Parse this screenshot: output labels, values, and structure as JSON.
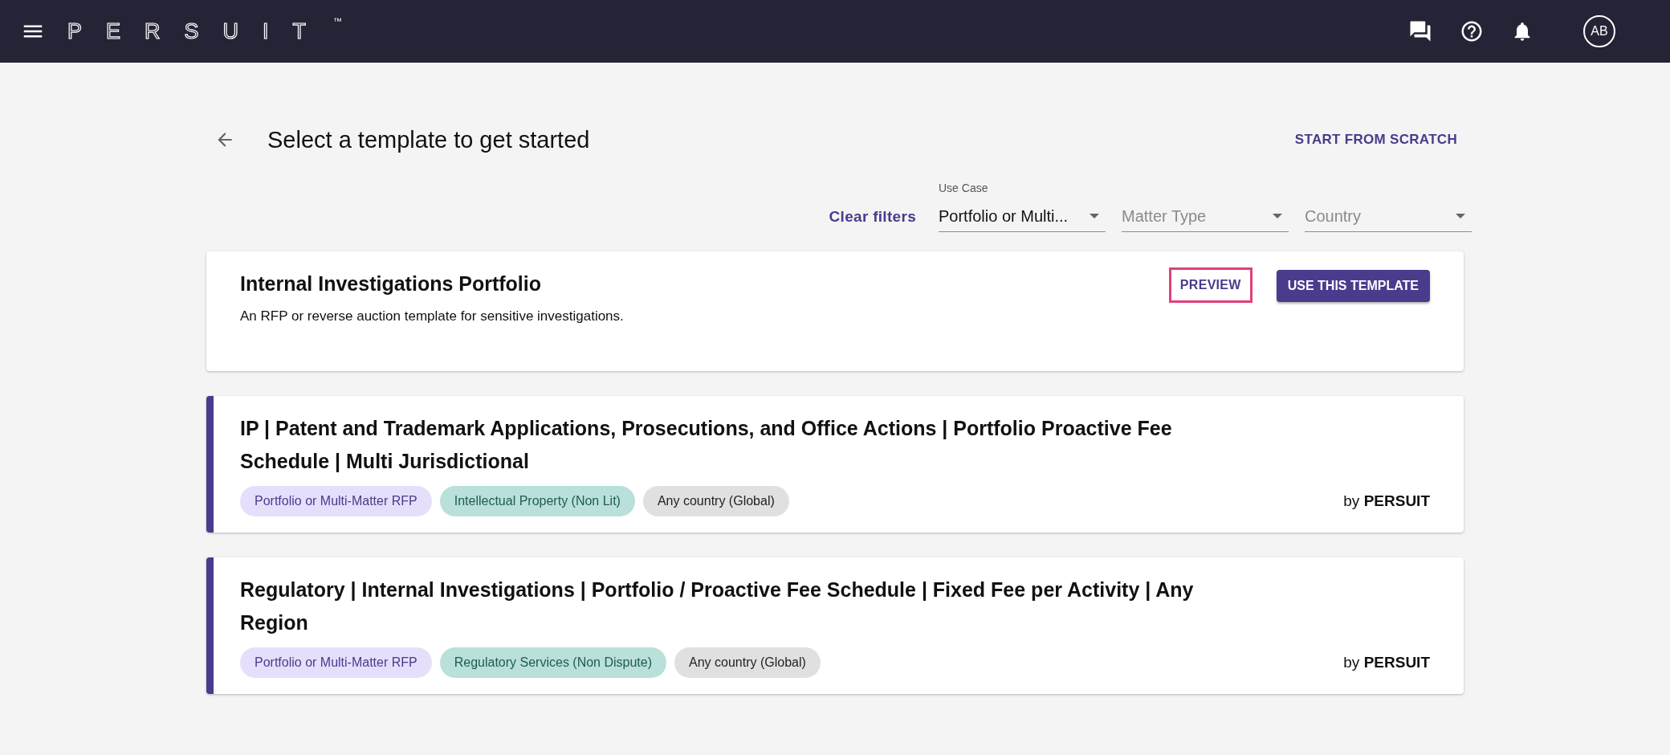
{
  "header": {
    "logo": "PERSUIT",
    "trademark": "™",
    "avatar": "AB"
  },
  "page": {
    "title": "Select a template to get started",
    "action": "START FROM SCRATCH"
  },
  "filters": {
    "clear": "Clear filters",
    "fields": [
      {
        "label": "Use Case",
        "value": "Portfolio or Multi..."
      },
      {
        "placeholder": "Matter Type"
      },
      {
        "placeholder": "Country"
      }
    ]
  },
  "featured": {
    "title": "Internal Investigations Portfolio",
    "description": "An RFP or reverse auction template for sensitive investigations.",
    "preview": {
      "label": "PREVIEW",
      "outlined": true
    },
    "use": "USE THIS TEMPLATE"
  },
  "templates": [
    {
      "title": "IP | Patent and Trademark Applications, Prosecutions, and Office Actions | Portfolio Proactive Fee Schedule | Multi Jurisdictional",
      "author": "by **PERSUIT**",
      "tags": [
        {
          "label": "Portfolio or Multi-Matter RFP",
          "color": "#e6dffb"
        },
        {
          "label": "Intellectual Property (Non Lit)",
          "color": "#b9e0da"
        },
        {
          "label": "Any country (Global)",
          "color": "#e0e0e0"
        }
      ]
    },
    {
      "title": "Regulatory | Internal Investigations | Portfolio / Proactive Fee Schedule | Fixed Fee per Activity | Any Region",
      "author": "by **PERSUIT**",
      "tags": [
        {
          "label": "Portfolio or Multi-Matter RFP",
          "color": "#e6dffb"
        },
        {
          "label": "Regulatory Services (Non Dispute)",
          "color": "#b9e0da"
        },
        {
          "label": "Any country (Global)",
          "color": "#e0e0e0"
        }
      ]
    }
  ]
}
